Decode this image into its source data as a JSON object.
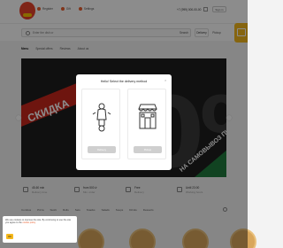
{
  "header": {
    "links": [
      {
        "label": "Register",
        "icon": "user-icon"
      },
      {
        "label": "Gift",
        "icon": "gift-icon"
      },
      {
        "label": "Settings",
        "icon": "gear-icon"
      }
    ],
    "phone": "+7 (999) 000-00-00",
    "signin_label": "Sign in"
  },
  "search": {
    "placeholder": "Enter the dish or",
    "search_label": "Search",
    "delivery_label": "Delivery",
    "pickup_label": "Pickup"
  },
  "nav": {
    "tabs": [
      "Menu",
      "Special offers",
      "Reviews",
      "About us"
    ]
  },
  "banner": {
    "discount_text": "СКИДКА",
    "big_number": "30%",
    "pickup_text": "НА САМОВЫВОЗ ПИЦЦЫ"
  },
  "info": [
    {
      "title": "45-60 min",
      "subtitle": "Delivery time"
    },
    {
      "title": "from 500 ₽",
      "subtitle": "Min. order"
    },
    {
      "title": "Free",
      "subtitle": "Delivery"
    },
    {
      "title": "Until 23:00",
      "subtitle": "Working hours"
    }
  ],
  "categories": [
    "Combos",
    "Pizza",
    "Sushi",
    "Rolls",
    "Sets",
    "Snacks",
    "Salads",
    "Soups",
    "Drinks",
    "Desserts"
  ],
  "modal": {
    "title": "Hello! Select the delivery method",
    "delivery_button": "Delivery",
    "pickup_button": "Pickup"
  },
  "cookie": {
    "text": "We use cookies to improve the site. By continuing to use the site you agree to the",
    "link_text": "cookie policy",
    "ok_label": "OK"
  },
  "colors": {
    "accent": "#f5b81c",
    "brand_red": "#e8432b",
    "banner_red": "#c9271d",
    "banner_green": "#1f7a3d"
  }
}
